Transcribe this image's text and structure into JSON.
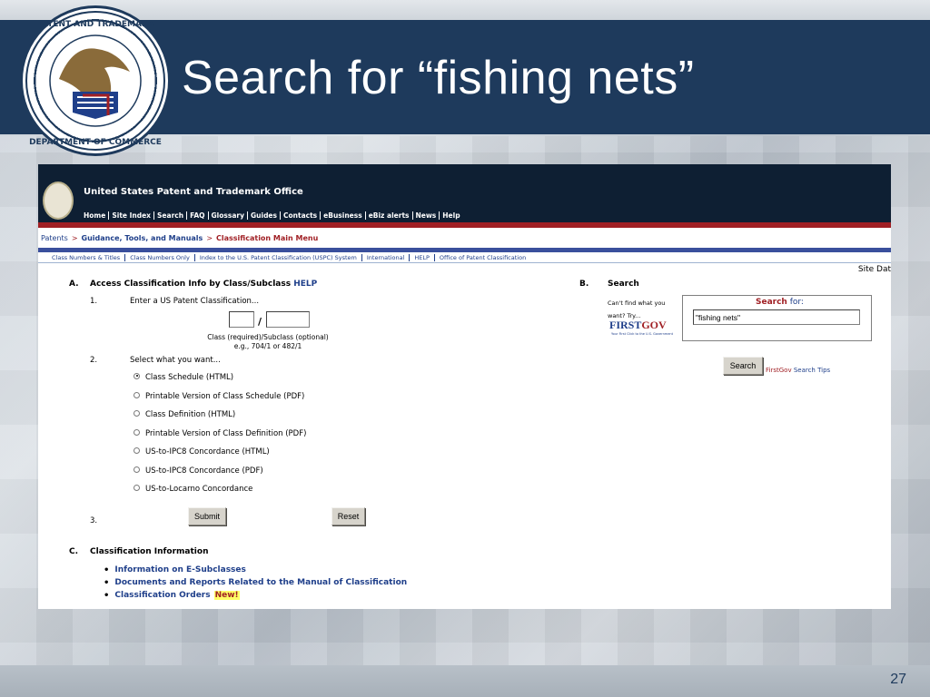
{
  "slide": {
    "title": "Search for “fishing nets”",
    "number": "27",
    "seal_name": "uspto-seal"
  },
  "site": {
    "org_name": "United States Patent and Trademark Office",
    "top_nav": [
      "Home",
      "Site Index",
      "Search",
      "FAQ",
      "Glossary",
      "Guides",
      "Contacts",
      "eBusiness",
      "eBiz alerts",
      "News",
      "Help"
    ],
    "breadcrumb": {
      "item1": "Patents",
      "sep": ">",
      "item2": "Guidance, Tools, and Manuals",
      "current": "Classification Main Menu"
    },
    "sub_nav": [
      "Class Numbers & Titles",
      "Class Numbers Only",
      "Index to the U.S. Patent Classification (USPC) System",
      "International",
      "HELP",
      "Office of Patent Classification"
    ],
    "site_dat": "Site Dat"
  },
  "sectionA": {
    "letter": "A.",
    "title": "Access Classification Info by Class/Subclass",
    "help_link": "HELP",
    "step1_num": "1.",
    "step1_label": "Enter a US Patent Classification...",
    "slash": "/",
    "class_value": "",
    "subclass_value": "",
    "hint_line1": "Class (required)/Subclass (optional)",
    "hint_line2": "e.g., 704/1 or 482/1",
    "step2_num": "2.",
    "step2_label": "Select what you want...",
    "options": [
      {
        "label": "Class Schedule (HTML)",
        "checked": true
      },
      {
        "label": "Printable Version of Class Schedule (PDF)",
        "checked": false
      },
      {
        "label": "Class Definition (HTML)",
        "checked": false
      },
      {
        "label": "Printable Version of Class Definition (PDF)",
        "checked": false
      },
      {
        "label": "US-to-IPC8 Concordance (HTML)",
        "checked": false
      },
      {
        "label": "US-to-IPC8 Concordance (PDF)",
        "checked": false
      },
      {
        "label": "US-to-Locarno Concordance",
        "checked": false
      }
    ],
    "step3_num": "3.",
    "submit_label": "Submit",
    "reset_label": "Reset"
  },
  "sectionB": {
    "letter": "B.",
    "title": "Search",
    "cant_find": "Can't find what you want? Try...",
    "firstgov_first": "FIRST",
    "firstgov_gov": "GOV",
    "firstgov_tagline": "Your First Click to the U.S. Government",
    "search_label_search": "Search",
    "search_label_for": " for:",
    "search_value": "\"fishing nets\"",
    "search_button": "Search",
    "link_first": "First",
    "link_gov": "Gov",
    "link_tips": " Search Tips"
  },
  "sectionC": {
    "letter": "C.",
    "title": "Classification Information",
    "items": [
      {
        "label": "Information on E-Subclasses"
      },
      {
        "label": "Documents and Reports Related to the Manual of Classification"
      },
      {
        "label": "Classification Orders"
      }
    ],
    "new_badge": "New!"
  },
  "colors": {
    "slide_band": "#1e3a5c",
    "site_header": "#0e1f33",
    "accent_red": "#a01f24",
    "link_blue": "#1f3f8a"
  }
}
